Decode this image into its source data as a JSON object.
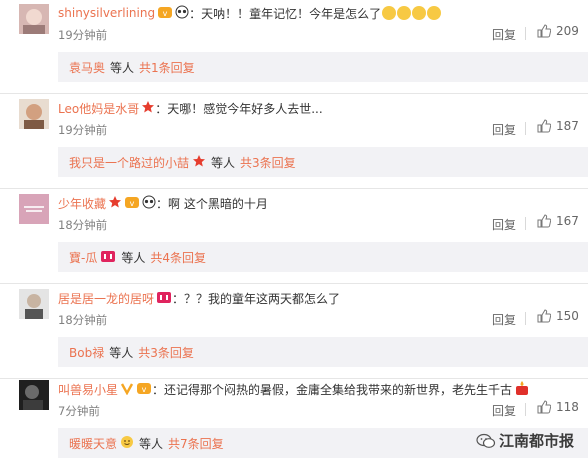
{
  "comments": [
    {
      "username": "shinysilverlining",
      "text": "：天呐！！童年记忆！今年是怎么了",
      "time": "19分钟前",
      "reply_label": "回复",
      "likes": "209",
      "sub_user": "袁马奥",
      "sub_deng": "等人",
      "sub_count": "共1条回复",
      "avatar_color": "#c9a9a6"
    },
    {
      "username": "Leo他妈是水哥",
      "text": "：天哪！感觉今年好多人去世...",
      "time": "19分钟前",
      "reply_label": "回复",
      "likes": "187",
      "sub_user": "我只是一个路过的小喆",
      "sub_deng": "等人",
      "sub_count": "共3条回复",
      "avatar_color": "#b08a6e"
    },
    {
      "username": "少年收藏",
      "text": "：啊 这个黑暗的十月",
      "time": "18分钟前",
      "reply_label": "回复",
      "likes": "167",
      "sub_user": "寶-瓜",
      "sub_deng": "等人",
      "sub_count": "共4条回复",
      "avatar_color": "#d8a4b8"
    },
    {
      "username": "居是居一龙的居呀",
      "text": "：？？我的童年这两天都怎么了",
      "time": "18分钟前",
      "reply_label": "回复",
      "likes": "150",
      "sub_user": "Bob禄",
      "sub_deng": "等人",
      "sub_count": "共3条回复",
      "avatar_color": "#8c8c8c"
    },
    {
      "username": "叫兽易小星",
      "text": "：还记得那个闷热的暑假，金庸全集给我带来的新世界，老先生千古",
      "time": "7分钟前",
      "reply_label": "回复",
      "likes": "118",
      "sub_user": "暖暖天意",
      "sub_deng": "等人",
      "sub_count": "共7条回复",
      "avatar_color": "#2d2d2d"
    }
  ],
  "watermark": "江南都市报",
  "colors": {
    "accent": "#eb7350",
    "sub_bg": "#f2f2f5",
    "muted": "#808080"
  }
}
